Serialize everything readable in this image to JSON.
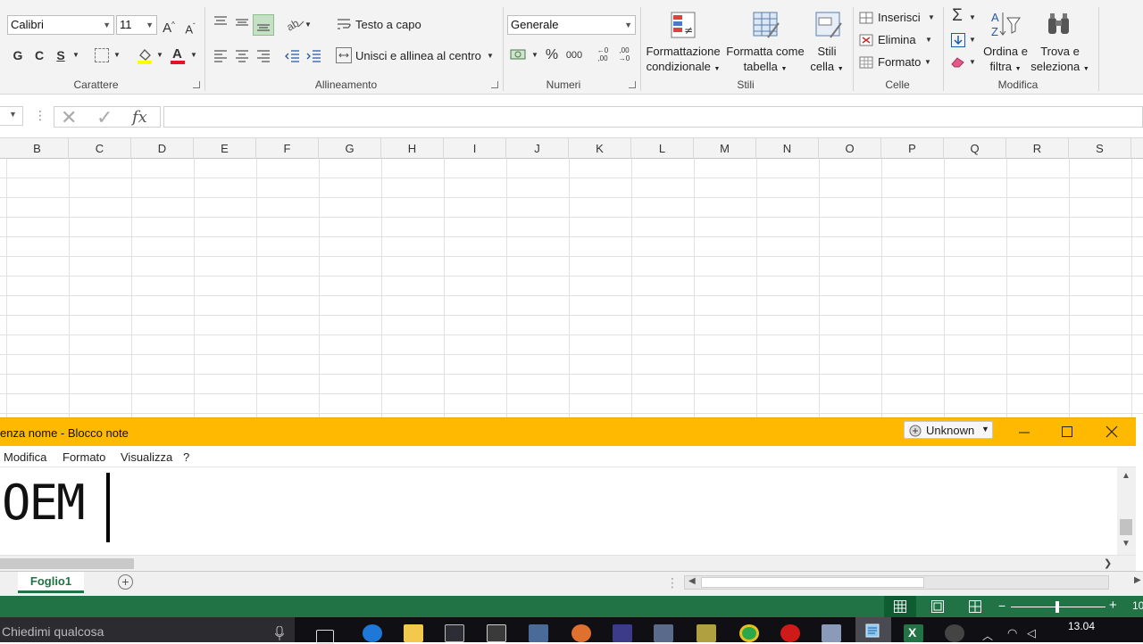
{
  "ribbon": {
    "font": {
      "name": "Calibri",
      "size": "11",
      "bold": "G",
      "italic": "C",
      "underline": "S",
      "grow": "A",
      "shrink": "A",
      "group_label": "Carattere"
    },
    "alignment": {
      "wrap_text": "Testo a capo",
      "merge_center": "Unisci e allinea al centro",
      "group_label": "Allineamento"
    },
    "number": {
      "format": "Generale",
      "percent": "%",
      "thousands": "000",
      "dec_inc": "←0 ,00",
      "dec_dec": ",00 →0",
      "group_label": "Numeri"
    },
    "styles": {
      "conditional_l1": "Formattazione",
      "conditional_l2": "condizionale",
      "as_table_l1": "Formatta come",
      "as_table_l2": "tabella",
      "cell_styles_l1": "Stili",
      "cell_styles_l2": "cella",
      "group_label": "Stili"
    },
    "cells": {
      "insert": "Inserisci",
      "delete": "Elimina",
      "format": "Formato",
      "group_label": "Celle"
    },
    "editing": {
      "autosum": "Σ",
      "sort_l1": "Ordina e",
      "sort_l2": "filtra",
      "find_l1": "Trova e",
      "find_l2": "seleziona",
      "group_label": "Modifica"
    }
  },
  "formula_bar": {
    "cancel": "✕",
    "confirm": "✓",
    "fx": "fx",
    "value": ""
  },
  "columns": [
    "B",
    "C",
    "D",
    "E",
    "F",
    "G",
    "H",
    "I",
    "J",
    "K",
    "L",
    "M",
    "N",
    "O",
    "P",
    "Q",
    "R",
    "S"
  ],
  "notepad": {
    "title": "enza nome - Blocco note",
    "ime_badge": "Unknown",
    "menu": [
      "Modifica",
      "Formato",
      "Visualizza",
      "?"
    ],
    "content": "OEM"
  },
  "sheets": {
    "active": "Foglio1",
    "add": "+"
  },
  "taskbar": {
    "search_placeholder": "Chiedimi qualcosa",
    "time": "13.04",
    "zoom_partial": "10"
  },
  "colors": {
    "excel_green": "#217346",
    "notepad_yellow": "#ffb900",
    "taskbar": "#101014"
  }
}
